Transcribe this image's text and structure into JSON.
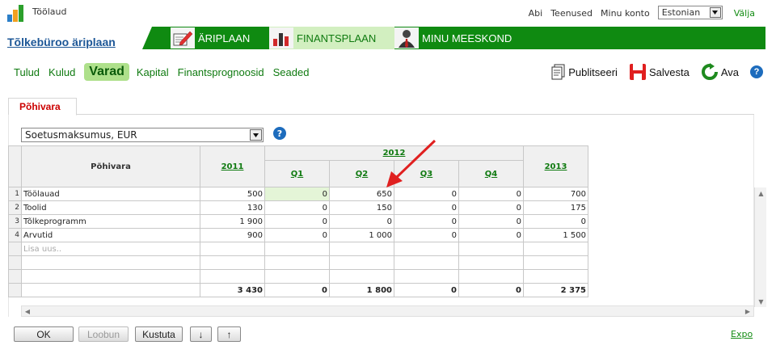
{
  "app": {
    "title": "Töölaud",
    "project_name": "Tõlkebüroo äriplaan"
  },
  "top_links": {
    "help": "Abi",
    "services": "Teenused",
    "account": "Minu konto",
    "language": "Estonian",
    "exit": "Välja"
  },
  "main_nav": [
    {
      "label": "ÄRIPLAAN",
      "icon": "pencil-document-icon"
    },
    {
      "label": "FINANTSPLAAN",
      "icon": "bar-chart-icon",
      "active": true
    },
    {
      "label": "MINU MEESKOND",
      "icon": "person-icon"
    }
  ],
  "sub_nav": [
    {
      "label": "Tulud"
    },
    {
      "label": "Kulud"
    },
    {
      "label": "Varad",
      "active": true
    },
    {
      "label": "Kapital"
    },
    {
      "label": "Finantsprognoosid"
    },
    {
      "label": "Seaded"
    }
  ],
  "actions": {
    "publish": "Publitseeri",
    "save": "Salvesta",
    "open": "Ava"
  },
  "panel": {
    "tab_label": "Põhivara",
    "select_value": "Soetusmaksumus, EUR"
  },
  "grid": {
    "row_header": "Põhivara",
    "year_2011": "2011",
    "year_2012": "2012",
    "year_2013": "2013",
    "quarters": [
      "Q1",
      "Q2",
      "Q3",
      "Q4"
    ],
    "rows": [
      {
        "num": "1",
        "name": "Töölauad",
        "y2011": "500",
        "q1": "0",
        "q2": "650",
        "q3": "0",
        "q4": "0",
        "y2013": "700"
      },
      {
        "num": "2",
        "name": "Toolid",
        "y2011": "130",
        "q1": "0",
        "q2": "150",
        "q3": "0",
        "q4": "0",
        "y2013": "175"
      },
      {
        "num": "3",
        "name": "Tõlkeprogramm",
        "y2011": "1 900",
        "q1": "0",
        "q2": "0",
        "q3": "0",
        "q4": "0",
        "y2013": "0"
      },
      {
        "num": "4",
        "name": "Arvutid",
        "y2011": "900",
        "q1": "0",
        "q2": "1 000",
        "q3": "0",
        "q4": "0",
        "y2013": "1 500"
      }
    ],
    "add_new_placeholder": "Lisa uus..",
    "totals": {
      "y2011": "3 430",
      "q1": "0",
      "q2": "1 800",
      "q3": "0",
      "q4": "0",
      "y2013": "2 375"
    }
  },
  "buttons": {
    "ok": "OK",
    "cancel": "Loobun",
    "delete": "Kustuta",
    "move_down": "↓",
    "move_up": "↑"
  },
  "export_link": "Expo",
  "colors": {
    "brand_green": "#0f8a11",
    "active_tab_bg": "#d2efc0",
    "subnav_active_bg": "#aee08b",
    "link_blue": "#1d5797",
    "tab_red": "#cc0000",
    "annotation_arrow": "#e02020"
  }
}
